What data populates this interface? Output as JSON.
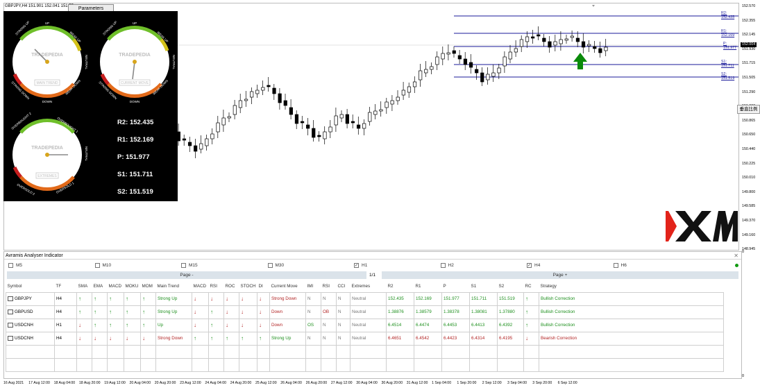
{
  "chart": {
    "symbol_info": "GBPJPY,H4  151.901 152.041 151.75",
    "parameters_label": "Parameters",
    "y_ticks": [
      "152.570",
      "152.355",
      "152.145",
      "151.930",
      "151.715",
      "151.505",
      "151.290",
      "151.080",
      "150.865",
      "150.650",
      "150.440",
      "150.225",
      "150.010",
      "149.800",
      "149.585",
      "149.370",
      "149.160",
      "148.945"
    ],
    "level_labels": {
      "r2": "R2: 152.435",
      "r1": "R1: 152.169",
      "p": "P: 151.977",
      "s1": "S1: 151.711",
      "s2": "S2: 151.519"
    },
    "current_price": "152.004",
    "chinese_button": "垂直比例",
    "x_ticks": [
      "16 Aug 2021",
      "17 Aug 12:00",
      "18 Aug 04:00",
      "18 Aug 20:00",
      "19 Aug 12:00",
      "20 Aug 04:00",
      "20 Aug 20:00",
      "23 Aug 12:00",
      "24 Aug 04:00",
      "24 Aug 20:00",
      "25 Aug 12:00",
      "26 Aug 04:00",
      "26 Aug 20:00",
      "27 Aug 12:00",
      "30 Aug 04:00",
      "30 Aug 20:00",
      "31 Aug 12:00",
      "1 Sep 04:00",
      "1 Sep 20:00",
      "2 Sep 12:00",
      "3 Sep 04:00",
      "3 Sep 20:00",
      "6 Sep 12:00"
    ],
    "zero_right": "0",
    "zero_bottom": "0",
    "brand": "XM",
    "colors": {
      "level_line": "#1a1a9a",
      "arrow": "#0a8a0a",
      "brand_red": "#e2231a"
    }
  },
  "gauges": {
    "main_trend": {
      "brand": "TRADEPEDIA",
      "caption": "MAIN TREND",
      "labels": {
        "top": "UP",
        "tl": "STRONG UP",
        "tr": "WEAK UP",
        "right": "NEUTRAL",
        "br": "WEAK DOWN",
        "bottom": "DOWN",
        "bl": "STRONG DOWN"
      }
    },
    "current_move": {
      "brand": "TRADEPEDIA",
      "caption": "CURRENT MOVE",
      "labels": {
        "top": "UP",
        "tl": "STRONG UP",
        "tr": "WEAK UP",
        "right": "NEUTRAL",
        "br": "WEAK DOWN",
        "bottom": "DOWN",
        "bl": "STRONG DOWN"
      }
    },
    "extremes": {
      "brand": "TRADEPEDIA",
      "caption": "EXTREMES",
      "labels": {
        "tl": "OVERBOUGHT 2",
        "tr": "OVERBOUGHT 1",
        "right": "NEUTRAL",
        "bl": "OVERSOLD 2",
        "br": "OVERSOLD 1"
      }
    }
  },
  "pivots": {
    "r2": "R2: 152.435",
    "r1": "R1: 152.169",
    "p": "P:   151.977",
    "s1": "S1: 151.711",
    "s2": "S2: 151.519"
  },
  "indicator": {
    "title": "Avramis Analyser Indicator",
    "close": "✕",
    "timeframes": [
      {
        "label": "M5",
        "checked": false
      },
      {
        "label": "M10",
        "checked": false
      },
      {
        "label": "M15",
        "checked": false
      },
      {
        "label": "M30",
        "checked": false
      },
      {
        "label": "H1",
        "checked": true
      },
      {
        "label": "H2",
        "checked": false
      },
      {
        "label": "H4",
        "checked": true
      },
      {
        "label": "H6",
        "checked": false
      }
    ],
    "page_prev": "Page -",
    "page_num": "1/1",
    "page_next": "Page +",
    "headers": [
      "Symbol",
      "TF",
      "SMA",
      "EMA",
      "MACD",
      "MOKU",
      "MOM",
      "Main Trend",
      "MACD",
      "RSI",
      "ROC",
      "STOCH",
      "DI",
      "Current Move",
      "IMI",
      "RSI",
      "CCI",
      "Extremes",
      "R2",
      "R1",
      "P",
      "S1",
      "S2",
      "RC",
      "Strategy"
    ],
    "rows": [
      {
        "symbol": "GBPJPY",
        "tf": "H4",
        "sma": "up",
        "ema": "up",
        "macd": "up",
        "moku": "up",
        "mom": "up",
        "main_trend": "Strong Up",
        "mt_color": "green",
        "macd2": "down",
        "rsi": "down",
        "roc": "down",
        "stoch": "down",
        "di": "down",
        "current_move": "Strong Down",
        "cm_color": "red",
        "imi": "N",
        "rsi2": "N",
        "cci": "N",
        "extremes": "Neutral",
        "r2": "152.435",
        "r1": "152.169",
        "p": "151.977",
        "s1": "151.711",
        "s2": "151.519",
        "lvl_color": "green",
        "rc": "up",
        "strategy": "Bullish Correction",
        "st_color": "green"
      },
      {
        "symbol": "GBPUSD",
        "tf": "H4",
        "sma": "up",
        "ema": "up",
        "macd": "up",
        "moku": "up",
        "mom": "up",
        "main_trend": "Strong Up",
        "mt_color": "green",
        "macd2": "down",
        "rsi": "up",
        "roc": "down",
        "stoch": "down",
        "di": "down",
        "current_move": "Down",
        "cm_color": "red",
        "imi": "N",
        "rsi2": "OB",
        "cci": "N",
        "extremes": "Neutral",
        "r2": "1.38876",
        "r1": "1.38579",
        "p": "1.38378",
        "s1": "1.38081",
        "s2": "1.37880",
        "lvl_color": "green",
        "rc": "up",
        "strategy": "Bullish Correction",
        "st_color": "green"
      },
      {
        "symbol": "USDCNH",
        "tf": "H1",
        "sma": "down",
        "ema": "up",
        "macd": "up",
        "moku": "up",
        "mom": "up",
        "main_trend": "Up",
        "mt_color": "green",
        "macd2": "down",
        "rsi": "up",
        "roc": "down",
        "stoch": "down",
        "di": "down",
        "current_move": "Down",
        "cm_color": "red",
        "imi": "OS",
        "rsi2": "N",
        "cci": "N",
        "extremes": "Neutral",
        "r2": "6.4514",
        "r1": "6.4474",
        "p": "6.4453",
        "s1": "6.4413",
        "s2": "6.4392",
        "lvl_color": "green",
        "rc": "up",
        "strategy": "Bullish Correction",
        "st_color": "green"
      },
      {
        "symbol": "USDCNH",
        "tf": "H4",
        "sma": "down",
        "ema": "down",
        "macd": "down",
        "moku": "down",
        "mom": "down",
        "main_trend": "Strong Down",
        "mt_color": "red",
        "macd2": "up",
        "rsi": "up",
        "roc": "up",
        "stoch": "up",
        "di": "up",
        "current_move": "Strong Up",
        "cm_color": "green",
        "imi": "N",
        "rsi2": "N",
        "cci": "N",
        "extremes": "Neutral",
        "r2": "6.4651",
        "r1": "6.4542",
        "p": "6.4423",
        "s1": "6.4314",
        "s2": "6.4195",
        "lvl_color": "red",
        "rc": "down",
        "strategy": "Bearish Correction",
        "st_color": "red"
      }
    ],
    "empty_rows": 2,
    "status_dot_color": "#119a11"
  }
}
